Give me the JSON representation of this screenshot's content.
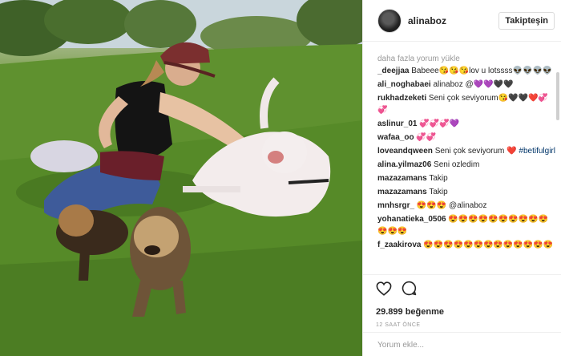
{
  "post": {
    "username": "alinaboz",
    "follow_label": "Takipteşin"
  },
  "comments_section": {
    "load_more": "daha fazla yorum yükle",
    "items": [
      {
        "user": "_deejjaa",
        "text": "Babeee😘😘😘lov u lotssss👽👽👽👽"
      },
      {
        "user": "ali_noghabaei",
        "text": "alinaboz @💜💜🖤🖤"
      },
      {
        "user": "rukhadzeketi",
        "text": "Seni çok seviyorum😘🖤🖤❤️💞💞"
      },
      {
        "user": "aslinur_01",
        "text": "💞💞💞💜"
      },
      {
        "user": "wafaa_oo",
        "text": "💞💞"
      },
      {
        "user": "loveandqween",
        "text": "Seni çok seviyorum ❤️",
        "hashtag": "#betifulgirl"
      },
      {
        "user": "alina.yilmaz06",
        "text": "Seni ozledim"
      },
      {
        "user": "mazazamans",
        "text": "Takip"
      },
      {
        "user": "mazazamans",
        "text": "Takip"
      },
      {
        "user": "mnhsrgr_",
        "text": "😍😍😍 @alinaboz"
      },
      {
        "user": "yohanatieka_0506",
        "text": "😍😍😍😍😍😍😍😍😍😍😍😍😍"
      },
      {
        "user": "f_zaakirova",
        "text": "😍😍😍😍😍😍😍😍😍😍😍😍😍"
      }
    ]
  },
  "actions": {
    "likes": "29.899 beğenme",
    "time": "12 SAAT ÖNCE",
    "like_icon": "heart-icon",
    "comment_icon": "comment-bubble-icon"
  },
  "add_comment": {
    "placeholder": "Yorum ekle..."
  },
  "colors": {
    "grass": "#5d8e2e",
    "hashtag": "#003569",
    "muted": "#999999"
  }
}
